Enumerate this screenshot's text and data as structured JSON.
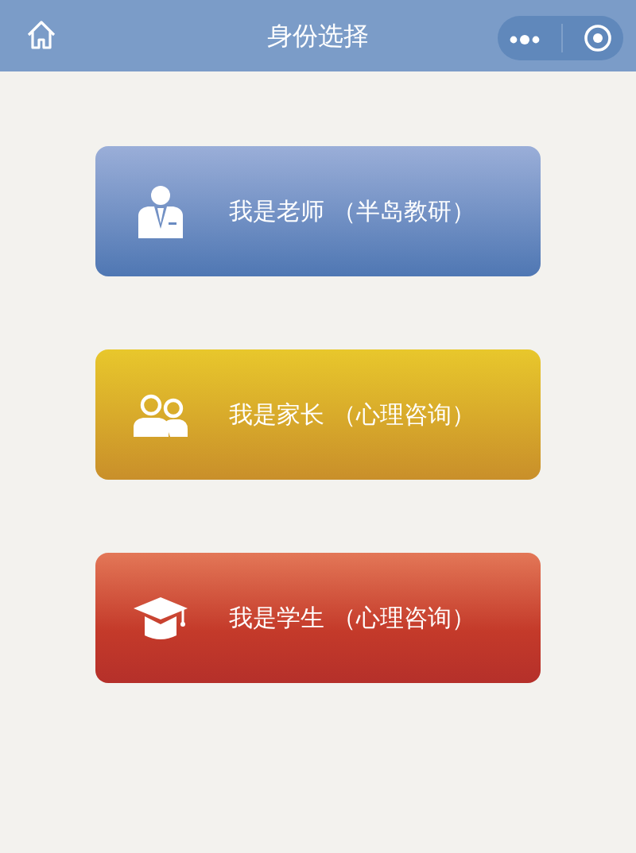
{
  "window": {
    "title": "身份选择"
  },
  "roles": [
    {
      "kind": "teacher",
      "label": "我是老师 （半岛教研）"
    },
    {
      "kind": "parent",
      "label": "我是家长 （心理咨询）"
    },
    {
      "kind": "student",
      "label": "我是学生 （心理咨询）"
    }
  ]
}
